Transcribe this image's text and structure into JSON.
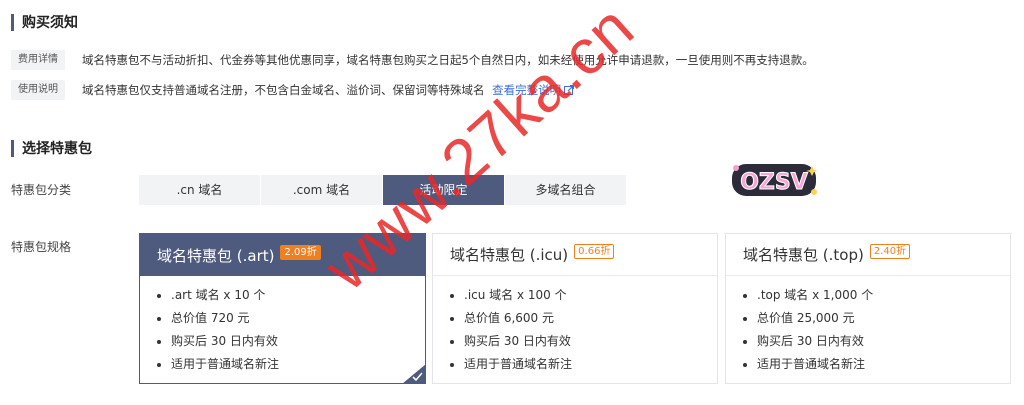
{
  "notice": {
    "title": "购买须知",
    "rows": [
      {
        "tag": "费用详情",
        "text": "域名特惠包不与活动折扣、代金券等其他优惠同享，域名特惠包购买之日起5个自然日内，如未经使用允许申请退款，一旦使用则不再支持退款。"
      },
      {
        "tag": "使用说明",
        "text": "域名特惠包仅支持普通域名注册，不包含白金域名、溢价词、保留词等特殊域名",
        "link": "查看完整说明"
      }
    ]
  },
  "choose": {
    "title": "选择特惠包",
    "category_label": "特惠包分类",
    "spec_label": "特惠包规格",
    "tabs": [
      ".cn 域名",
      ".com 域名",
      "活动限定",
      "多域名组合"
    ],
    "active_tab": "活动限定"
  },
  "sticker_text": "OZSV",
  "cards": [
    {
      "title": "域名特惠包 (.art)",
      "badge": "2.09折",
      "selected": true,
      "items": [
        ".art 域名 x 10 个",
        "总价值 720 元",
        "购买后 30 日内有效",
        "适用于普通域名新注"
      ]
    },
    {
      "title": "域名特惠包 (.icu)",
      "badge": "0.66折",
      "selected": false,
      "items": [
        ".icu 域名 x 100 个",
        "总价值 6,600 元",
        "购买后 30 日内有效",
        "适用于普通域名新注"
      ]
    },
    {
      "title": "域名特惠包 (.top)",
      "badge": "2.40折",
      "selected": false,
      "items": [
        ".top 域名 x 1,000 个",
        "总价值 25,000 元",
        "购买后 30 日内有效",
        "适用于普通域名新注"
      ]
    }
  ],
  "watermark": "www.27ka.cn",
  "colors": {
    "accent": "#4e5a7e",
    "badge": "#f0801f",
    "link": "#3c6fd8",
    "watermark": "#e82828"
  }
}
